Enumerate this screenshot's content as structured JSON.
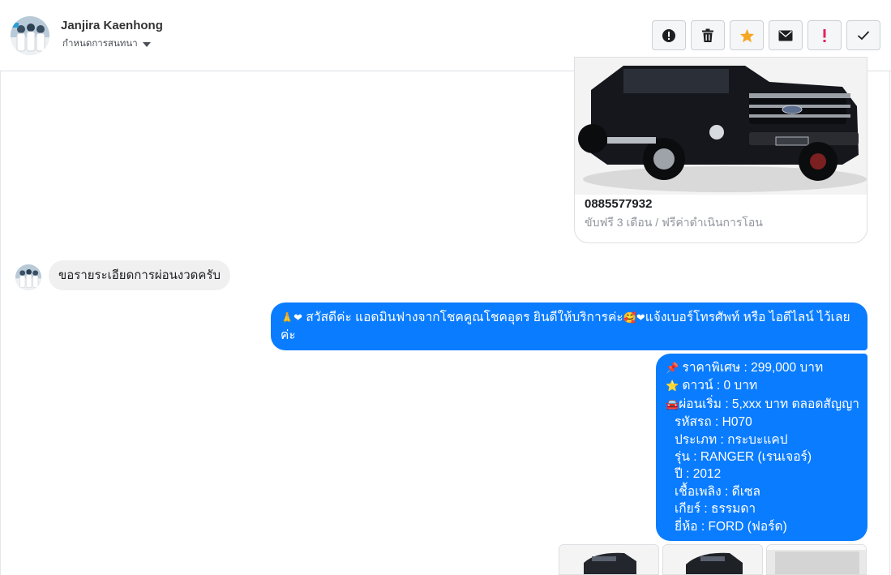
{
  "header": {
    "contact_name": "Janjira Kaenhong",
    "assign_label": "กำหนดการสนทนา"
  },
  "toolbar": {
    "actions": [
      {
        "icon": "alert-circle-icon",
        "label": ""
      },
      {
        "icon": "trash-icon",
        "label": ""
      },
      {
        "icon": "star-icon",
        "label": ""
      },
      {
        "icon": "envelope-icon",
        "label": ""
      },
      {
        "icon": "exclamation-icon",
        "label": ""
      },
      {
        "icon": "check-icon",
        "label": ""
      }
    ],
    "colors": {
      "star": "#f5a623",
      "exclamation": "#e0245e"
    }
  },
  "messages": {
    "ad_card": {
      "title": "0885577932",
      "subtitle": "ขับฟรี 3 เดือน / ฟรีค่าดำเนินการโอน",
      "image": "car-photo"
    },
    "incoming": {
      "text": "ขอรายระเอียดการผ่อนงวดครับ"
    },
    "outgoing_greeting": {
      "emoji_lead": "🙏❤",
      "text": " สวัสดีค่ะ แอดมินฟางจากโชคคูณโชคอุดร ยินดีให้บริการค่ะ",
      "emoji_mid": "🥰❤",
      "text2": "แจ้งเบอร์โทรศัพท์ หรือ ไอดีไลน์  ไว้เลยค่ะ"
    },
    "outgoing_details": {
      "lines": [
        {
          "emoji": "📌",
          "text": "ราคาพิเศษ : 299,000 บาท"
        },
        {
          "emoji": "⭐",
          "text": " ดาวน์ : 0 บาท"
        },
        {
          "emoji": "🚘",
          "text": "ผ่อนเริ่ม : 5,xxx บาท ตลอดสัญญา"
        },
        {
          "emoji": "",
          "text": "รหัสรถ : H070"
        },
        {
          "emoji": "",
          "text": "ประเภท : กระบะแคป"
        },
        {
          "emoji": "",
          "text": "รุ่น : RANGER (เรนเจอร์)"
        },
        {
          "emoji": "",
          "text": "ปี : 2012"
        },
        {
          "emoji": "",
          "text": "เชื้อเพลิง : ดีเซล"
        },
        {
          "emoji": "",
          "text": "เกียร์ : ธรรมดา"
        },
        {
          "emoji": "",
          "text": "ยี่ห้อ : FORD (ฟอร์ด)"
        }
      ]
    },
    "photo_thumbnails": [
      "car-photo-1",
      "car-photo-2",
      "car-photo-3"
    ]
  },
  "colors": {
    "outgoing_bubble": "#0a7cff",
    "incoming_bubble": "#f1f0f0",
    "muted_text": "#90949c"
  }
}
